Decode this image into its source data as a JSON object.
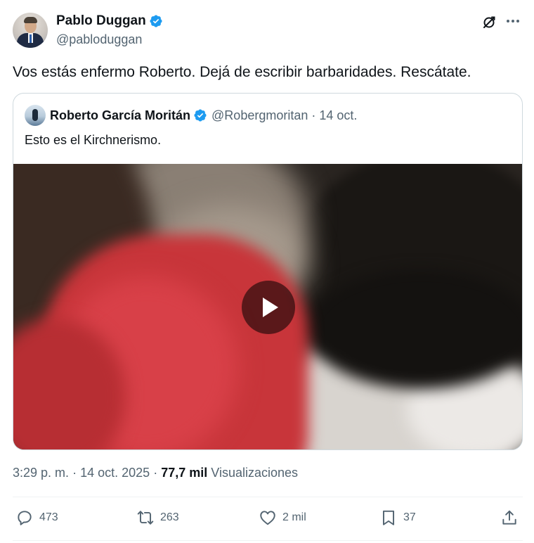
{
  "author": {
    "display_name": "Pablo Duggan",
    "handle": "@pabloduggan",
    "verified": true
  },
  "tweet": {
    "text": "Vos estás enfermo Roberto. Dejá de escribir barbaridades. Rescátate."
  },
  "quoted": {
    "display_name": "Roberto García Moritán",
    "handle": "@Robergmoritan",
    "separator": "·",
    "date": "14 oct.",
    "text": "Esto es el Kirchnerismo.",
    "media_type": "video"
  },
  "meta": {
    "time": "3:29 p. m.",
    "separator": "·",
    "date": "14 oct. 2025",
    "views_count": "77,7 mil",
    "views_label": "Visualizaciones"
  },
  "actions": {
    "replies": "473",
    "reposts": "263",
    "likes": "2 mil",
    "bookmarks": "37"
  },
  "icons": {
    "verified": "verified-badge-icon",
    "grok": "grok-icon",
    "more": "more-icon",
    "play": "play-icon",
    "reply": "reply-icon",
    "repost": "repost-icon",
    "like": "like-icon",
    "bookmark": "bookmark-icon",
    "share": "share-icon"
  },
  "colors": {
    "verified": "#1d9bf0",
    "text_primary": "#0f1419",
    "text_secondary": "#536471",
    "border": "#cfd9de"
  }
}
